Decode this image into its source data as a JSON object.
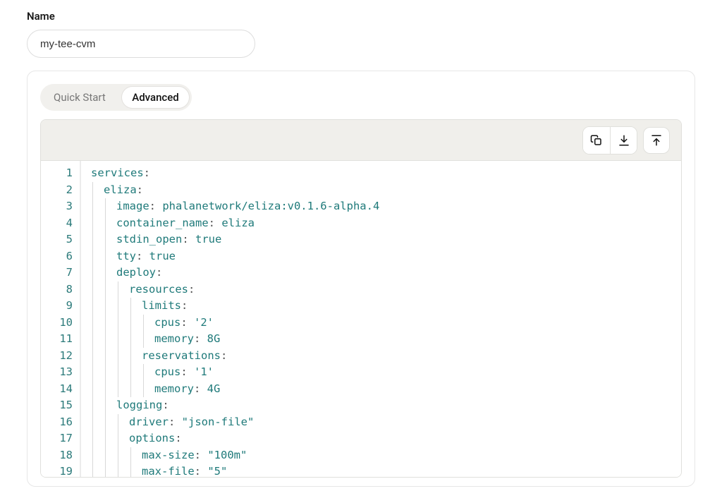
{
  "form": {
    "name_label": "Name",
    "name_value": "my-tee-cvm",
    "name_placeholder": ""
  },
  "tabs": {
    "quick_start": "Quick Start",
    "advanced": "Advanced",
    "active": "advanced"
  },
  "toolbar": {
    "copy": "copy-icon",
    "download": "download-icon",
    "upload": "upload-icon"
  },
  "code": {
    "lines": [
      {
        "n": 1,
        "indent": 0,
        "text": "services:"
      },
      {
        "n": 2,
        "indent": 1,
        "text": "eliza:"
      },
      {
        "n": 3,
        "indent": 2,
        "key": "image",
        "after": "phalanetwork/eliza:v0.1.6-alpha.4"
      },
      {
        "n": 4,
        "indent": 2,
        "key": "container_name",
        "after": "eliza"
      },
      {
        "n": 5,
        "indent": 2,
        "key": "stdin_open",
        "bool": "true"
      },
      {
        "n": 6,
        "indent": 2,
        "key": "tty",
        "bool": "true"
      },
      {
        "n": 7,
        "indent": 2,
        "text": "deploy:"
      },
      {
        "n": 8,
        "indent": 3,
        "text": "resources:"
      },
      {
        "n": 9,
        "indent": 4,
        "text": "limits:"
      },
      {
        "n": 10,
        "indent": 5,
        "key": "cpus",
        "str": "'2'"
      },
      {
        "n": 11,
        "indent": 5,
        "key": "memory",
        "after": "8G"
      },
      {
        "n": 12,
        "indent": 4,
        "text": "reservations:"
      },
      {
        "n": 13,
        "indent": 5,
        "key": "cpus",
        "str": "'1'"
      },
      {
        "n": 14,
        "indent": 5,
        "key": "memory",
        "after": "4G"
      },
      {
        "n": 15,
        "indent": 2,
        "text": "logging:"
      },
      {
        "n": 16,
        "indent": 3,
        "key": "driver",
        "str": "\"json-file\""
      },
      {
        "n": 17,
        "indent": 3,
        "text": "options:"
      },
      {
        "n": 18,
        "indent": 4,
        "key": "max-size",
        "str": "\"100m\""
      },
      {
        "n": 19,
        "indent": 4,
        "key": "max-file",
        "str": "\"5\""
      }
    ]
  }
}
